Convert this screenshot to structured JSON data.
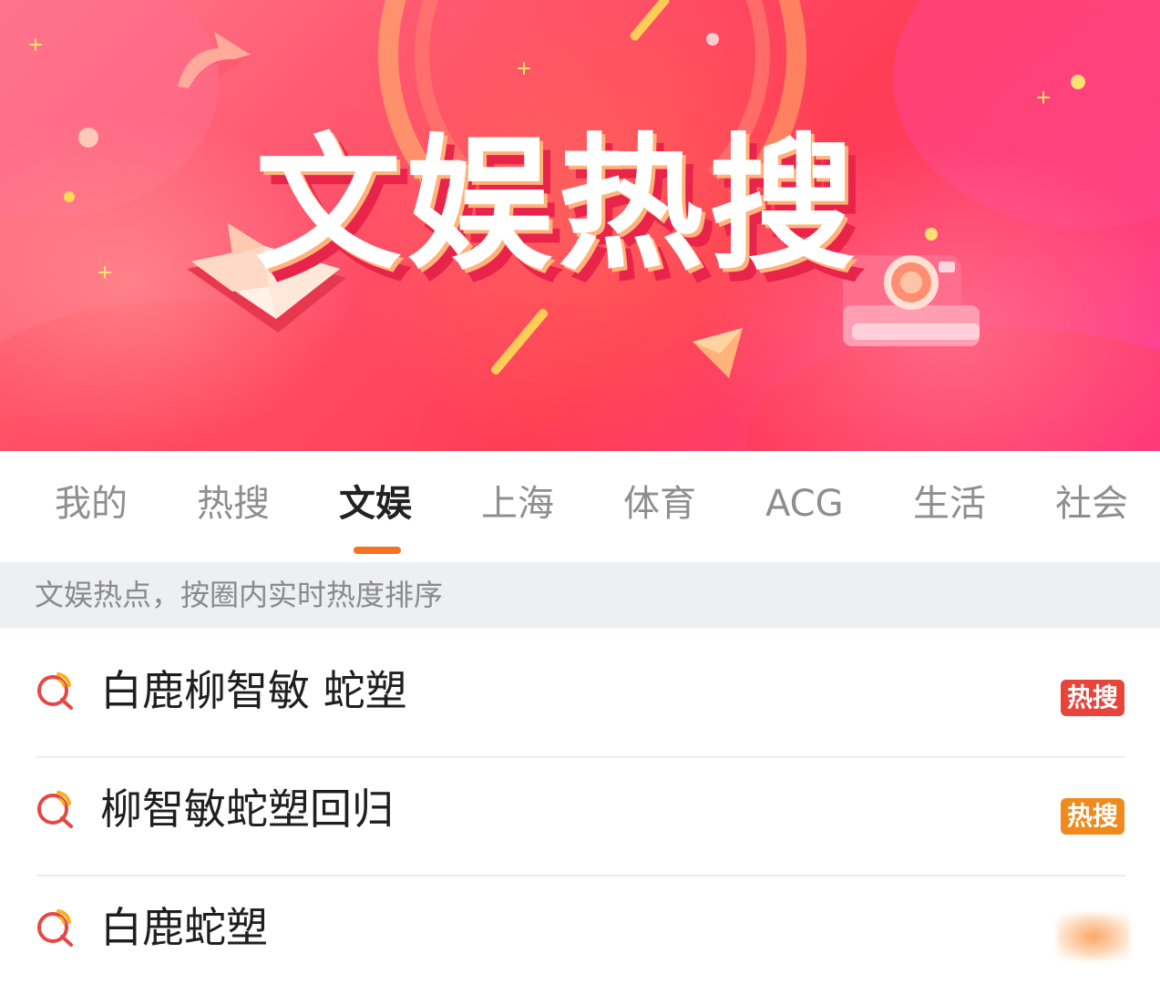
{
  "banner": {
    "title": "文娱热搜"
  },
  "tabs": [
    {
      "label": "我的",
      "active": false
    },
    {
      "label": "热搜",
      "active": false
    },
    {
      "label": "文娱",
      "active": true
    },
    {
      "label": "上海",
      "active": false
    },
    {
      "label": "体育",
      "active": false
    },
    {
      "label": "ACG",
      "active": false
    },
    {
      "label": "生活",
      "active": false
    },
    {
      "label": "社会",
      "active": false
    }
  ],
  "subtitle": "文娱热点，按圈内实时热度排序",
  "list": [
    {
      "label": "白鹿柳智敏 蛇塑",
      "badge": "热搜",
      "badge_color": "#e8443a"
    },
    {
      "label": "柳智敏蛇塑回归",
      "badge": "热搜",
      "badge_color": "#f08a1c"
    },
    {
      "label": "白鹿蛇塑",
      "badge": "",
      "badge_color": "#f7a35a"
    }
  ],
  "colors": {
    "accent": "#f5731e",
    "banner_primary": "#ff4f6a",
    "search_icon_red": "#e84545",
    "search_icon_yellow": "#f5b21e"
  },
  "icons": [
    "search-icon",
    "book-icon",
    "camera-icon",
    "arrow-icon"
  ]
}
